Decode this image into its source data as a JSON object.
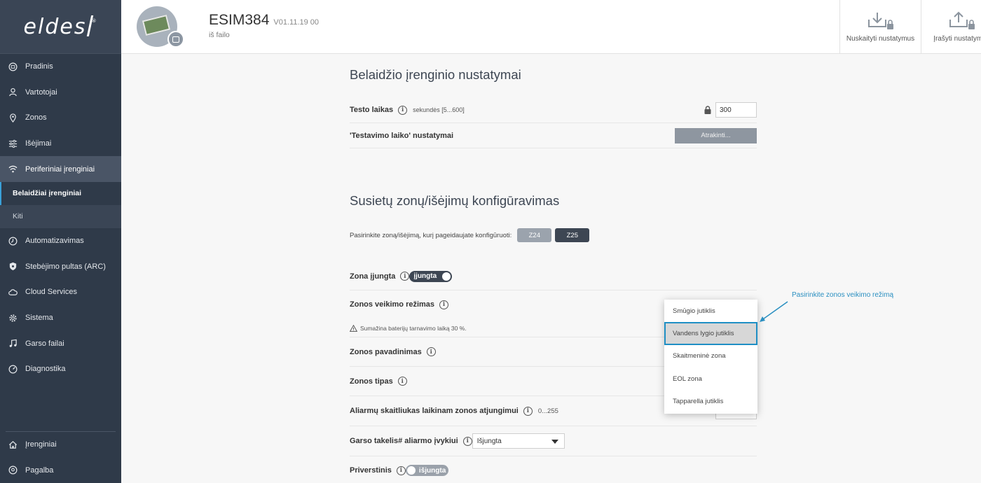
{
  "brand": {
    "logo_text": "eldes",
    "registered": "®"
  },
  "sidebar": {
    "items": [
      {
        "label": "Pradinis",
        "icon": "home-circle-icon"
      },
      {
        "label": "Vartotojai",
        "icon": "user-icon"
      },
      {
        "label": "Zonos",
        "icon": "location-pin-icon"
      },
      {
        "label": "Išėjimai",
        "icon": "sliders-icon"
      },
      {
        "label": "Periferiniai įrenginiai",
        "icon": "wifi-icon"
      }
    ],
    "subitems": [
      {
        "label": "Belaidžiai įrenginiai"
      },
      {
        "label": "Kiti"
      }
    ],
    "items2": [
      {
        "label": "Automatizavimas",
        "icon": "clock-icon"
      },
      {
        "label": "Stebėjimo pultas (ARC)",
        "icon": "shield-icon"
      },
      {
        "label": "Cloud Services",
        "icon": "cloud-icon"
      },
      {
        "label": "Sistema",
        "icon": "gear-icon"
      },
      {
        "label": "Garso failai",
        "icon": "music-note-icon"
      },
      {
        "label": "Diagnostika",
        "icon": "gauge-icon"
      }
    ],
    "bottom": [
      {
        "label": "Įrenginiai",
        "icon": "house-icon"
      },
      {
        "label": "Pagalba",
        "icon": "help-icon"
      }
    ]
  },
  "header": {
    "device_name": "ESIM384",
    "version": "V01.11.19 00",
    "source": "iš failo",
    "download_label": "Nuskaityti nustatymus",
    "upload_label": "Įrašyti nustatymus"
  },
  "wireless": {
    "title": "Belaidžio įrenginio nustatymai",
    "test_time_label": "Testo laikas",
    "test_time_hint": "sekundės [5...600]",
    "test_time_value": "300",
    "testing_settings_label": "'Testavimo laiko' nustatymai",
    "unlock_label": "Atrakinti..."
  },
  "linked": {
    "title": "Susietų zonų/išėjimų konfigūravimas",
    "select_prompt": "Pasirinkite zoną/išėjimą, kurį pageidaujate konfigūruoti:",
    "zone_buttons": [
      "Z24",
      "Z25"
    ],
    "zone_enabled_label": "Zona įjungta",
    "zone_enabled_state": "įjungta",
    "mode_label": "Zonos veikimo režimas",
    "mode_warning": "Sumažina baterijų tarnavimo laiką 30 %.",
    "name_label": "Zonos pavadinimas",
    "type_label": "Zonos tipas",
    "alarm_counter_label": "Aliarmų skaitliukas laikinam zonos atjungimui",
    "alarm_counter_hint": "0...255",
    "sound_label": "Garso takelis# aliarmo įvykiui",
    "sound_value": "Išjungta",
    "forced_label": "Priverstinis",
    "forced_state": "išjungta"
  },
  "dropdown": {
    "options": [
      "Smūgio jutiklis",
      "Vandens lygio jutiklis",
      "Skaitmeninė zona",
      "EOL zona",
      "Tapparella jutiklis"
    ],
    "selected_index": 1
  },
  "callout": {
    "text": "Pasirinkite zonos veikimo režimą"
  },
  "colors": {
    "sidebar": "#2f3a49",
    "accent": "#1f8fc4",
    "dark_button": "#3d4653"
  }
}
